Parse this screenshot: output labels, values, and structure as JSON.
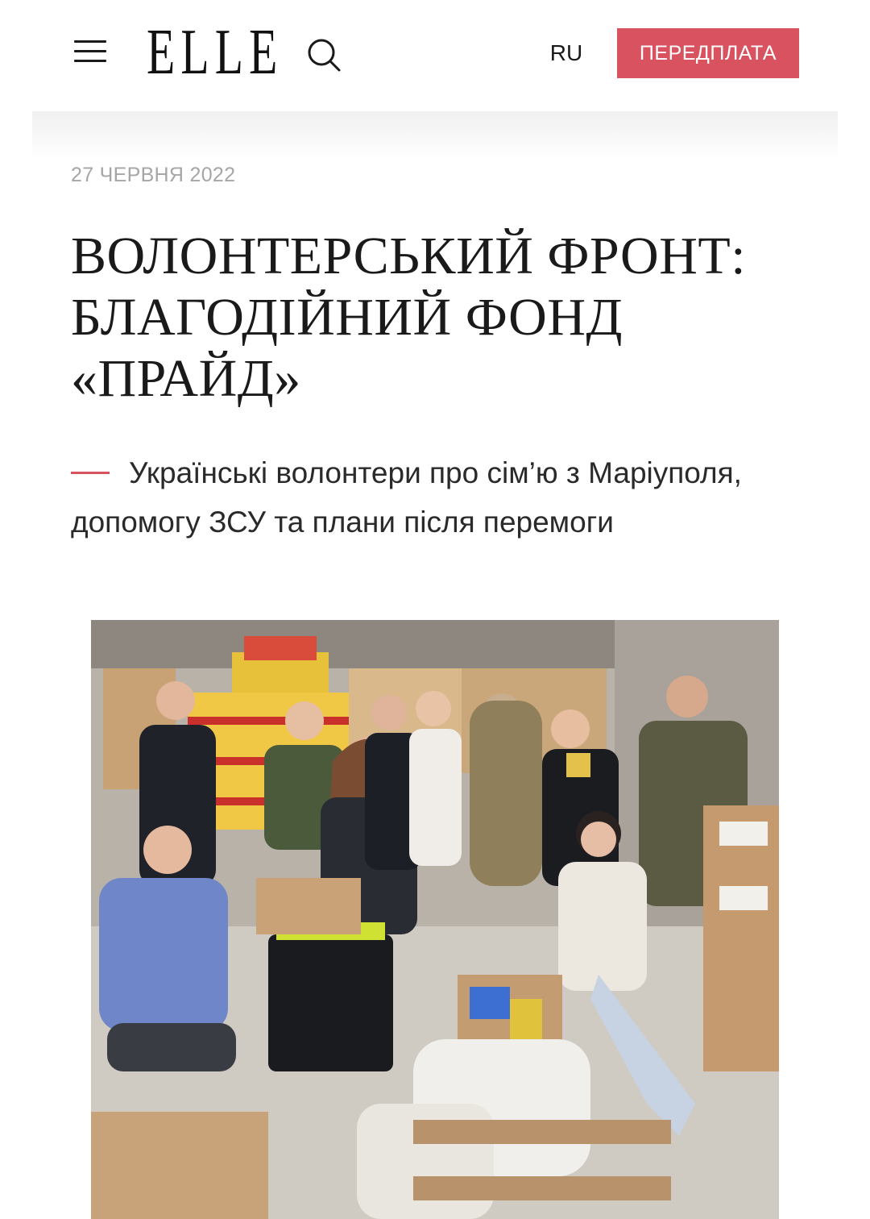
{
  "header": {
    "logo": "ELLE",
    "lang": "RU",
    "subscribe_label": "ПЕРЕДПЛАТА",
    "accent_color": "#d9525f"
  },
  "article": {
    "date": "27 ЧЕРВНЯ 2022",
    "title": "ВОЛОНТЕРСЬКИЙ ФРОНТ: БЛАГОДІЙНИЙ ФОНД «ПРАЙД»",
    "lead": "Українські волонтери про сім’ю з Маріуполя, допомогу ЗСУ та плани після перемоги"
  },
  "icons": {
    "menu": "hamburger-icon",
    "search": "search-icon"
  }
}
